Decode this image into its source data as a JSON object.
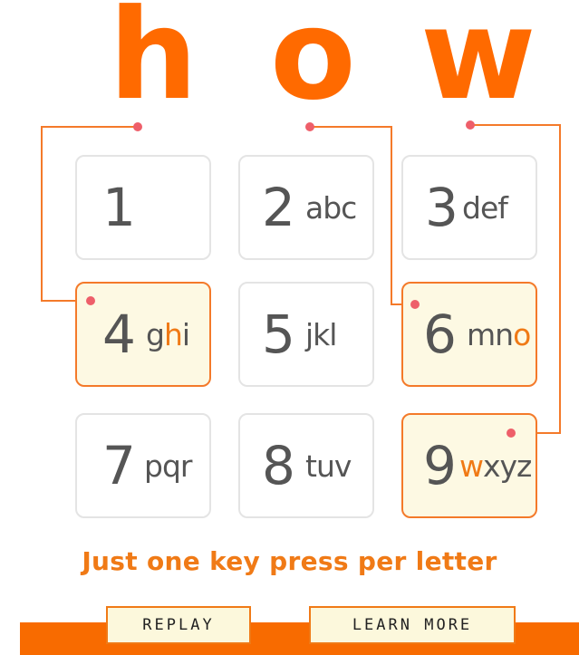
{
  "word_letters": [
    "h",
    "o",
    "w"
  ],
  "keys": [
    {
      "num": "1",
      "parts": [
        {
          "t": "",
          "hl": false
        }
      ]
    },
    {
      "num": "2",
      "parts": [
        {
          "t": "abc",
          "hl": false
        }
      ]
    },
    {
      "num": "3",
      "parts": [
        {
          "t": "def",
          "hl": false
        }
      ]
    },
    {
      "num": "4",
      "parts": [
        {
          "t": "g",
          "hl": false
        },
        {
          "t": "h",
          "hl": true
        },
        {
          "t": "i",
          "hl": false
        }
      ]
    },
    {
      "num": "5",
      "parts": [
        {
          "t": "jkl",
          "hl": false
        }
      ]
    },
    {
      "num": "6",
      "parts": [
        {
          "t": "mn",
          "hl": false
        },
        {
          "t": "o",
          "hl": true
        }
      ]
    },
    {
      "num": "7",
      "parts": [
        {
          "t": "pqr",
          "hl": false
        }
      ]
    },
    {
      "num": "8",
      "parts": [
        {
          "t": "tuv",
          "hl": false
        }
      ]
    },
    {
      "num": "9",
      "parts": [
        {
          "t": "w",
          "hl": true
        },
        {
          "t": "xyz",
          "hl": false
        }
      ]
    }
  ],
  "active_keys": [
    "4",
    "6",
    "9"
  ],
  "tagline": "Just one key press per letter",
  "buttons": {
    "replay": "REPLAY",
    "learn_more": "LEARN MORE"
  },
  "colors": {
    "accent": "#ff6a00",
    "connector": "#f47a2a",
    "dot": "#ee5f6a",
    "active_key_bg": "#fdf9e3"
  }
}
